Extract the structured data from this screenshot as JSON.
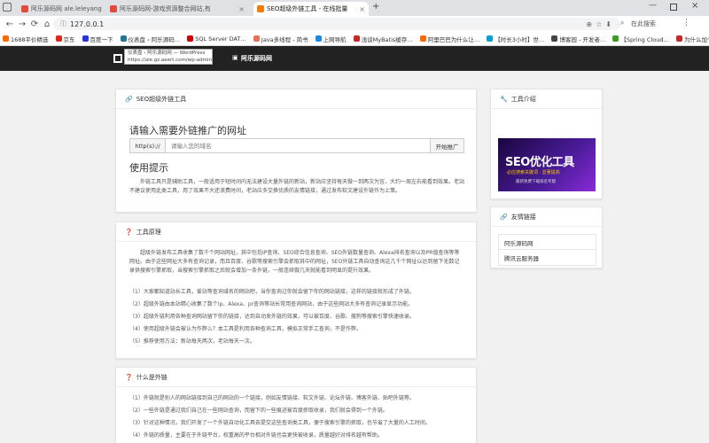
{
  "tabs": [
    {
      "title": "阿乐源码网 ale.leleyangyang.n",
      "fav_color": "#e24a3b",
      "active": false
    },
    {
      "title": "阿乐源码网-游戏资源整合网站,有",
      "fav_color": "#e24a3b",
      "active": false
    },
    {
      "title": "SEO超级外链工具 - 在线批量",
      "fav_color": "#f57c00",
      "active": true
    }
  ],
  "toolbar": {
    "url": "127.0.0.1",
    "search_placeholder": "在此搜索"
  },
  "bookmarks": [
    {
      "label": "1688平价精选",
      "color": "#ff6a00"
    },
    {
      "label": "京东",
      "color": "#e1251b"
    },
    {
      "label": "百度一下",
      "color": "#2932e1"
    },
    {
      "label": "仪表盘 ‹ 阿乐源码…",
      "color": "#21759b"
    },
    {
      "label": "SQL Server DAT…",
      "color": "#c00"
    },
    {
      "label": "Java多线程 - 简书",
      "color": "#ea6f5a"
    },
    {
      "label": "上网导航",
      "color": "#1e88e5"
    },
    {
      "label": "浅谈MyBatis缓存…",
      "color": "#c62828"
    },
    {
      "label": "阿里巴巴为什么让…",
      "color": "#ff6a00"
    },
    {
      "label": "【时长3小时】世…",
      "color": "#00a1d6"
    },
    {
      "label": "博客园 - 开发者…",
      "color": "#444"
    },
    {
      "label": "【Spring Cloud…",
      "color": "#3a9d23"
    },
    {
      "label": "为什么加个注解…",
      "color": "#c62828"
    },
    {
      "label": "MyBatis注解开发",
      "color": "#e53935"
    }
  ],
  "navbar": {
    "tooltip_line1": "仪表盘 ‹ 阿乐源码网 — WordPress",
    "tooltip_line2": "https://ale.gz.aeert.com/wp-admin",
    "link1": "阿乐源码网"
  },
  "tool": {
    "header": "SEO超级外链工具",
    "heading": "请输入需要外链推广的网址",
    "prefix": "http(s)://",
    "input_placeholder": "请输入您的域名",
    "button": "开始推广",
    "usage_title": "使用提示",
    "usage_text": "外链工具只是辅助工具，一般适用于短时间内无法建设大量外链的新站，新站应坚持每天做一到两次为宜，大约一周左右能看到效果。老站不建议使用此类工具，用了效果不大还浪费时间，老站应多交换优质的友情链接，通过发布软文建设外链作为上策。"
  },
  "principle": {
    "header": "工具原理",
    "intro": "超级外链发布工具收集了数千个网站网址，其中包括IP查询、SEO综合信息查询、SEO外链数量查询、Alexa排名查询以及PR值查询等等网址。由于这些网址大多有查询记录，而且百度、谷歌等搜索引擎会抓取其中的网址，SEO外链工具自动查询这几千个网址以达到留下无数记录供搜索引擎抓取，当搜索引擎抓取之后就会增加一条外链，一般连续做几天就能看到明显的提升效果。",
    "items": [
      "（1）大家都知道站长工具，爱站等查询域名的网站吧，当你查询过你就会留下你的网站链接，这样的链接就形成了外链。",
      "（2）超级外链由本站精心收集了数个ip、Alexa、pr查询等站长常用查询网站，由于这些网站大多有查询记录显示功能。",
      "（3）超级外链利用各种查询网站留下你的链接，达到自动发外链的效果，可以被百度、谷歌、搜狗等搜索引擎快速收录。",
      "（4）使用超级外链会被认为作弊么？本工具是利用各种查询工具，模拟正常手工查询，不是作弊。",
      "（5）推荐使用方法：新站每天两次，老站每天一次。"
    ]
  },
  "external": {
    "header": "什么是外链",
    "items": [
      "（1）外链就是别人的网站链接到自己的网站的一个链接，例如友情链接、软文外链、论坛外链、博客外链、贴吧外链等。",
      "（2）一些外链是通过我们自己在一些网站查询，而留下的一些痕迹被百度抓取收录，我们就会得到一个外链。",
      "（3）针对这种情况，我们开发了一个外链自动化工具去提交这些查询类工具，便于搜索引擎的抓取，也节省了大量的人工时间。",
      "（4）外链的质量，主要在于外链平台，权重高的平台相对外链也会更快被收录，质量越好对排名越有帮助。"
    ]
  },
  "intro_panel": {
    "header": "工具介绍",
    "banner_title": "SEO优化工具",
    "banner_sub": "必应搜索关键词 · 显著提高",
    "banner_small": "最新免费下载排名专题"
  },
  "links_panel": {
    "header": "友情链接",
    "items": [
      "阿乐源码网",
      "腾讯云服务器"
    ]
  },
  "colors": {
    "banner_bg": "#2a0a5e",
    "accent": "#f7c600"
  }
}
